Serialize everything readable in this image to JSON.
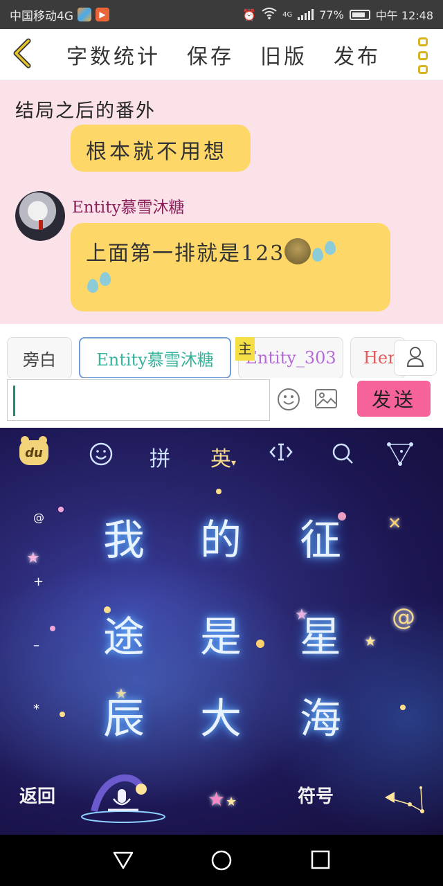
{
  "status_bar": {
    "carrier": "中国移动4G",
    "network": "4G",
    "battery": "77%",
    "time": "中午 12:48"
  },
  "toolbar": {
    "back_icon": "chevron-left-icon",
    "items": [
      "字数统计",
      "保存",
      "旧版",
      "发布"
    ],
    "more_icon": "more-vertical-icon",
    "accent": "#d7b31e"
  },
  "chat": {
    "title": "结局之后的番外",
    "previous_message": "根本就不用想",
    "message": {
      "sender": "Entity慕雪沐糖",
      "text": "上面第一排就是123"
    },
    "background": "#fbe2e9",
    "bubble_color": "#fdd869"
  },
  "roles": {
    "items": [
      "旁白",
      "Entity慕雪沐糖",
      "Entity_303",
      "Hero"
    ],
    "selected_index": 1,
    "main_badge": "主"
  },
  "composer": {
    "input_value": "",
    "send_label": "发送",
    "send_color": "#f6629a"
  },
  "keyboard": {
    "top_row": {
      "logo": "du",
      "pinyin": "拼",
      "english": "英"
    },
    "keys": [
      [
        "我",
        "的",
        "征"
      ],
      [
        "途",
        "是",
        "星"
      ],
      [
        "辰",
        "大",
        "海"
      ]
    ],
    "side_symbols": [
      "@",
      "+",
      "–",
      "*",
      "@"
    ],
    "bottom": {
      "back_label": "返回",
      "symbol_label": "符号"
    }
  },
  "nav_bar": {
    "icons": [
      "back-triangle-icon",
      "home-circle-icon",
      "recents-square-icon"
    ]
  }
}
